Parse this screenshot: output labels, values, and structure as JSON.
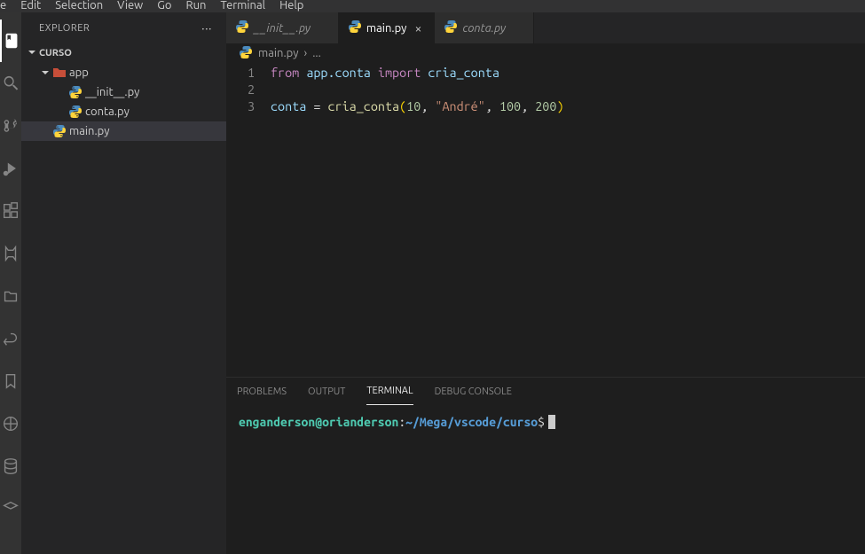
{
  "menu": [
    "e",
    "Edit",
    "Selection",
    "View",
    "Go",
    "Run",
    "Terminal",
    "Help"
  ],
  "sidebar": {
    "header": "EXPLORER",
    "section": "CURSO",
    "tree": [
      {
        "name": "app",
        "type": "folder",
        "indent": 1,
        "chevron": "down"
      },
      {
        "name": "__init__.py",
        "type": "python",
        "indent": 2
      },
      {
        "name": "conta.py",
        "type": "python",
        "indent": 2
      },
      {
        "name": "main.py",
        "type": "python",
        "indent": 1,
        "selected": true
      }
    ]
  },
  "tabs": [
    {
      "label": "__init__.py",
      "active": false
    },
    {
      "label": "main.py",
      "active": true
    },
    {
      "label": "conta.py",
      "active": false
    }
  ],
  "breadcrumbs": {
    "file": "main.py",
    "more": "..."
  },
  "code": {
    "lines": [
      1,
      2,
      3
    ],
    "line1": {
      "kw_from": "from",
      "mod": "app.conta",
      "kw_import": "import",
      "name": "cria_conta"
    },
    "line3": {
      "var": "conta",
      "eq": " = ",
      "fn": "cria_conta",
      "lp": "(",
      "n1": "10",
      "c1": ", ",
      "s1": "\"André\"",
      "c2": ", ",
      "n2": "100",
      "c3": ", ",
      "n3": "200",
      "rp": ")"
    }
  },
  "panel": {
    "tabs": [
      "PROBLEMS",
      "OUTPUT",
      "TERMINAL",
      "DEBUG CONSOLE"
    ],
    "active": "TERMINAL",
    "prompt": {
      "user": "enganderson@orianderson",
      "colon": ":",
      "path": "~/Mega/vscode/curso",
      "dollar": "$"
    }
  }
}
